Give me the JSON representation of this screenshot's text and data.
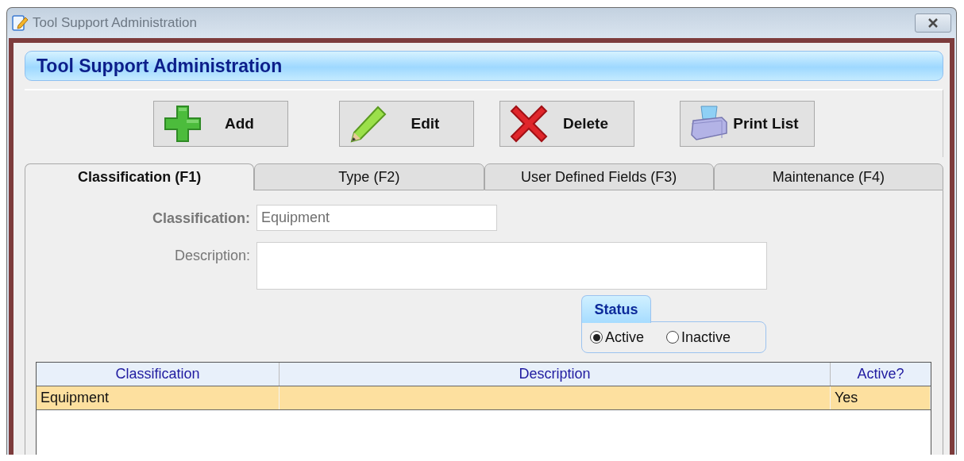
{
  "window": {
    "title": "Tool Support Administration"
  },
  "header": {
    "title": "Tool Support Administration"
  },
  "toolbar": [
    {
      "label": "Add",
      "kind": "add"
    },
    {
      "label": "Edit",
      "kind": "edit"
    },
    {
      "label": "Delete",
      "kind": "delete"
    },
    {
      "label": "Print List",
      "kind": "print"
    }
  ],
  "tabs": [
    {
      "label": "Classification (F1)",
      "selected": true
    },
    {
      "label": "Type (F2)",
      "selected": false
    },
    {
      "label": "User Defined Fields (F3)",
      "selected": false
    },
    {
      "label": "Maintenance (F4)",
      "selected": false
    }
  ],
  "form": {
    "classification": {
      "label": "Classification:",
      "value": "Equipment",
      "required": true
    },
    "description": {
      "label": "Description:",
      "required": false
    }
  },
  "status": {
    "title": "Status",
    "options": [
      {
        "label": "Active",
        "selected": true
      },
      {
        "label": "Inactive",
        "selected": false
      }
    ]
  },
  "table": {
    "columns": [
      "Classification",
      "Description",
      "Active?"
    ],
    "rows": [
      {
        "classification": "Equipment",
        "active": "Yes",
        "selected": true
      }
    ]
  }
}
